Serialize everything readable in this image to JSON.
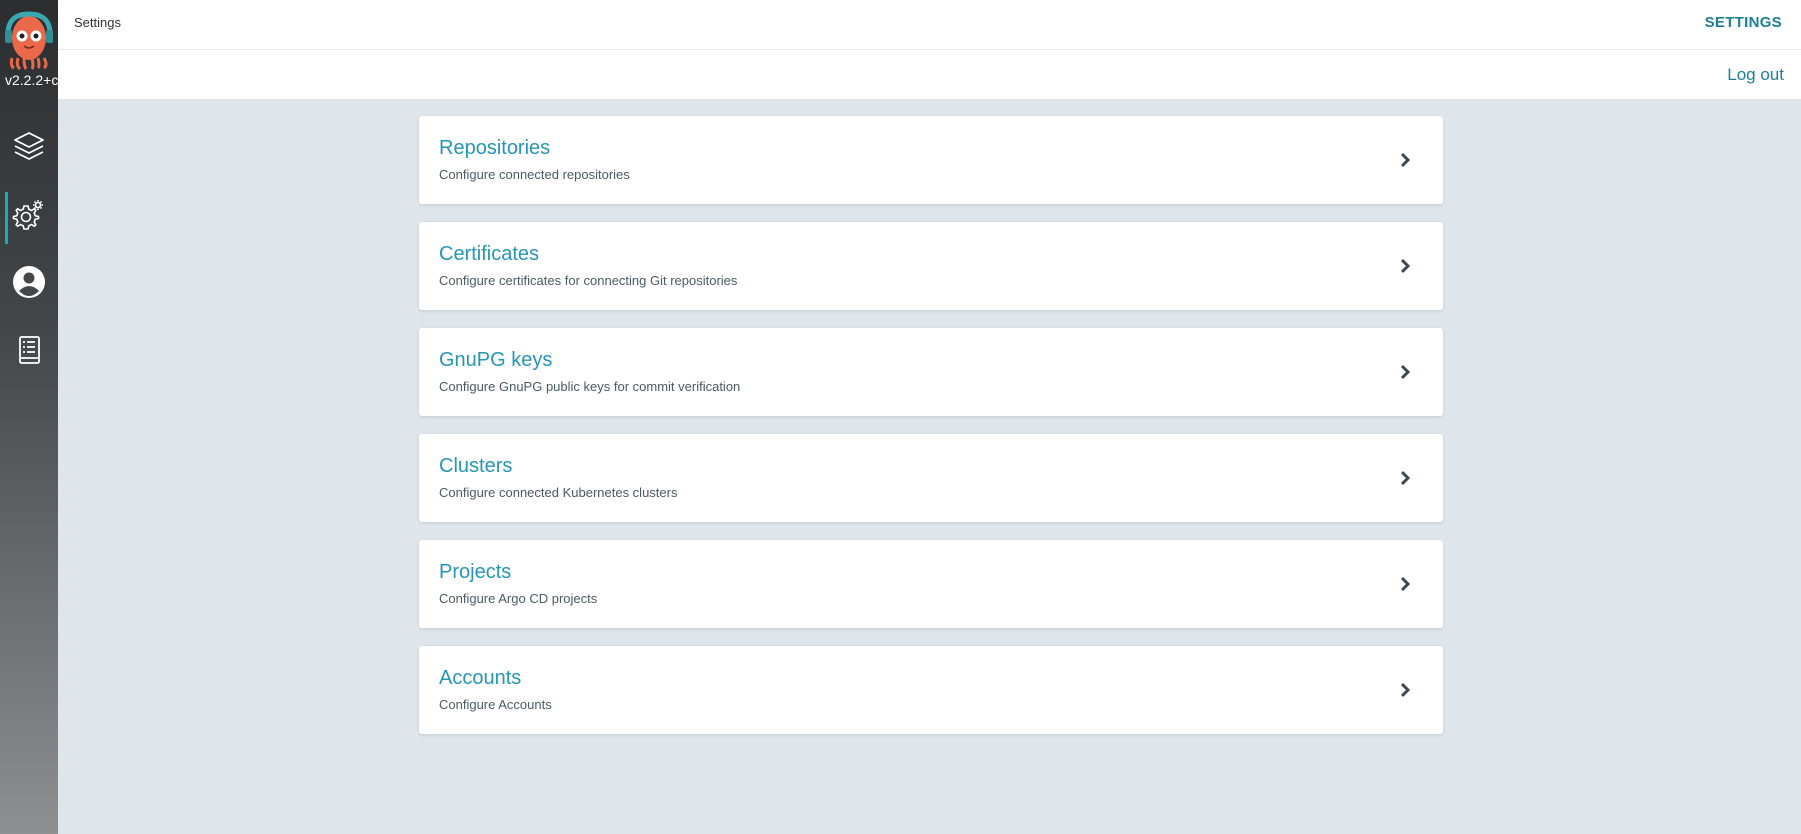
{
  "app": {
    "version": "v2.2.2+c",
    "page_title": "Settings",
    "section_label": "SETTINGS",
    "logout_label": "Log out"
  },
  "sidebar": {
    "items": [
      {
        "name": "applications",
        "icon": "layers-icon",
        "active": false
      },
      {
        "name": "settings",
        "icon": "gear-icon",
        "active": true
      },
      {
        "name": "user-info",
        "icon": "user-icon",
        "active": false
      },
      {
        "name": "docs",
        "icon": "book-icon",
        "active": false
      }
    ]
  },
  "settings": {
    "items": [
      {
        "title": "Repositories",
        "description": "Configure connected repositories"
      },
      {
        "title": "Certificates",
        "description": "Configure certificates for connecting Git repositories"
      },
      {
        "title": "GnuPG keys",
        "description": "Configure GnuPG public keys for commit verification"
      },
      {
        "title": "Clusters",
        "description": "Configure connected Kubernetes clusters"
      },
      {
        "title": "Projects",
        "description": "Configure Argo CD projects"
      },
      {
        "title": "Accounts",
        "description": "Configure Accounts"
      }
    ]
  },
  "colors": {
    "accent": "#1b7f98",
    "link": "#2596b6",
    "background": "#dee6eb",
    "active_indicator": "#16aeb8"
  }
}
